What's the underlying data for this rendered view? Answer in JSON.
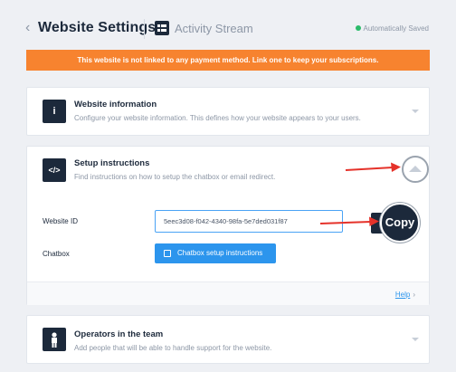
{
  "header": {
    "back_glyph": "‹",
    "title": "Website Settings",
    "stream_label": "Activity Stream",
    "save_status": "Automatically Saved"
  },
  "banner": {
    "text": "This website is not linked to any payment method. Link one to keep your subscriptions."
  },
  "cards": {
    "website_info": {
      "icon": "info-icon",
      "icon_glyph": "i",
      "title": "Website information",
      "description": "Configure your website information. This defines how your website appears to your users."
    },
    "setup": {
      "icon": "code-icon",
      "icon_glyph": "</>",
      "title": "Setup instructions",
      "description": "Find instructions on how to setup the chatbox or email redirect.",
      "website_id_label": "Website ID",
      "website_id_value": "5eec3d08-f042-4340-98fa-5e7ded031f87",
      "copy_label": "Copy",
      "chatbox_label": "Chatbox",
      "chatbox_button": "Chatbox setup instructions",
      "help_link": "Help",
      "help_chevron": "›"
    },
    "operators": {
      "icon": "person-icon",
      "title": "Operators in the team",
      "description": "Add people that will be able to handle support for the website."
    }
  },
  "colors": {
    "banner": "#f7832f",
    "primary": "#2c95ed",
    "dark": "#1c293b",
    "annotation_arrow": "#e5322a",
    "saved_dot": "#2bbb6a"
  }
}
